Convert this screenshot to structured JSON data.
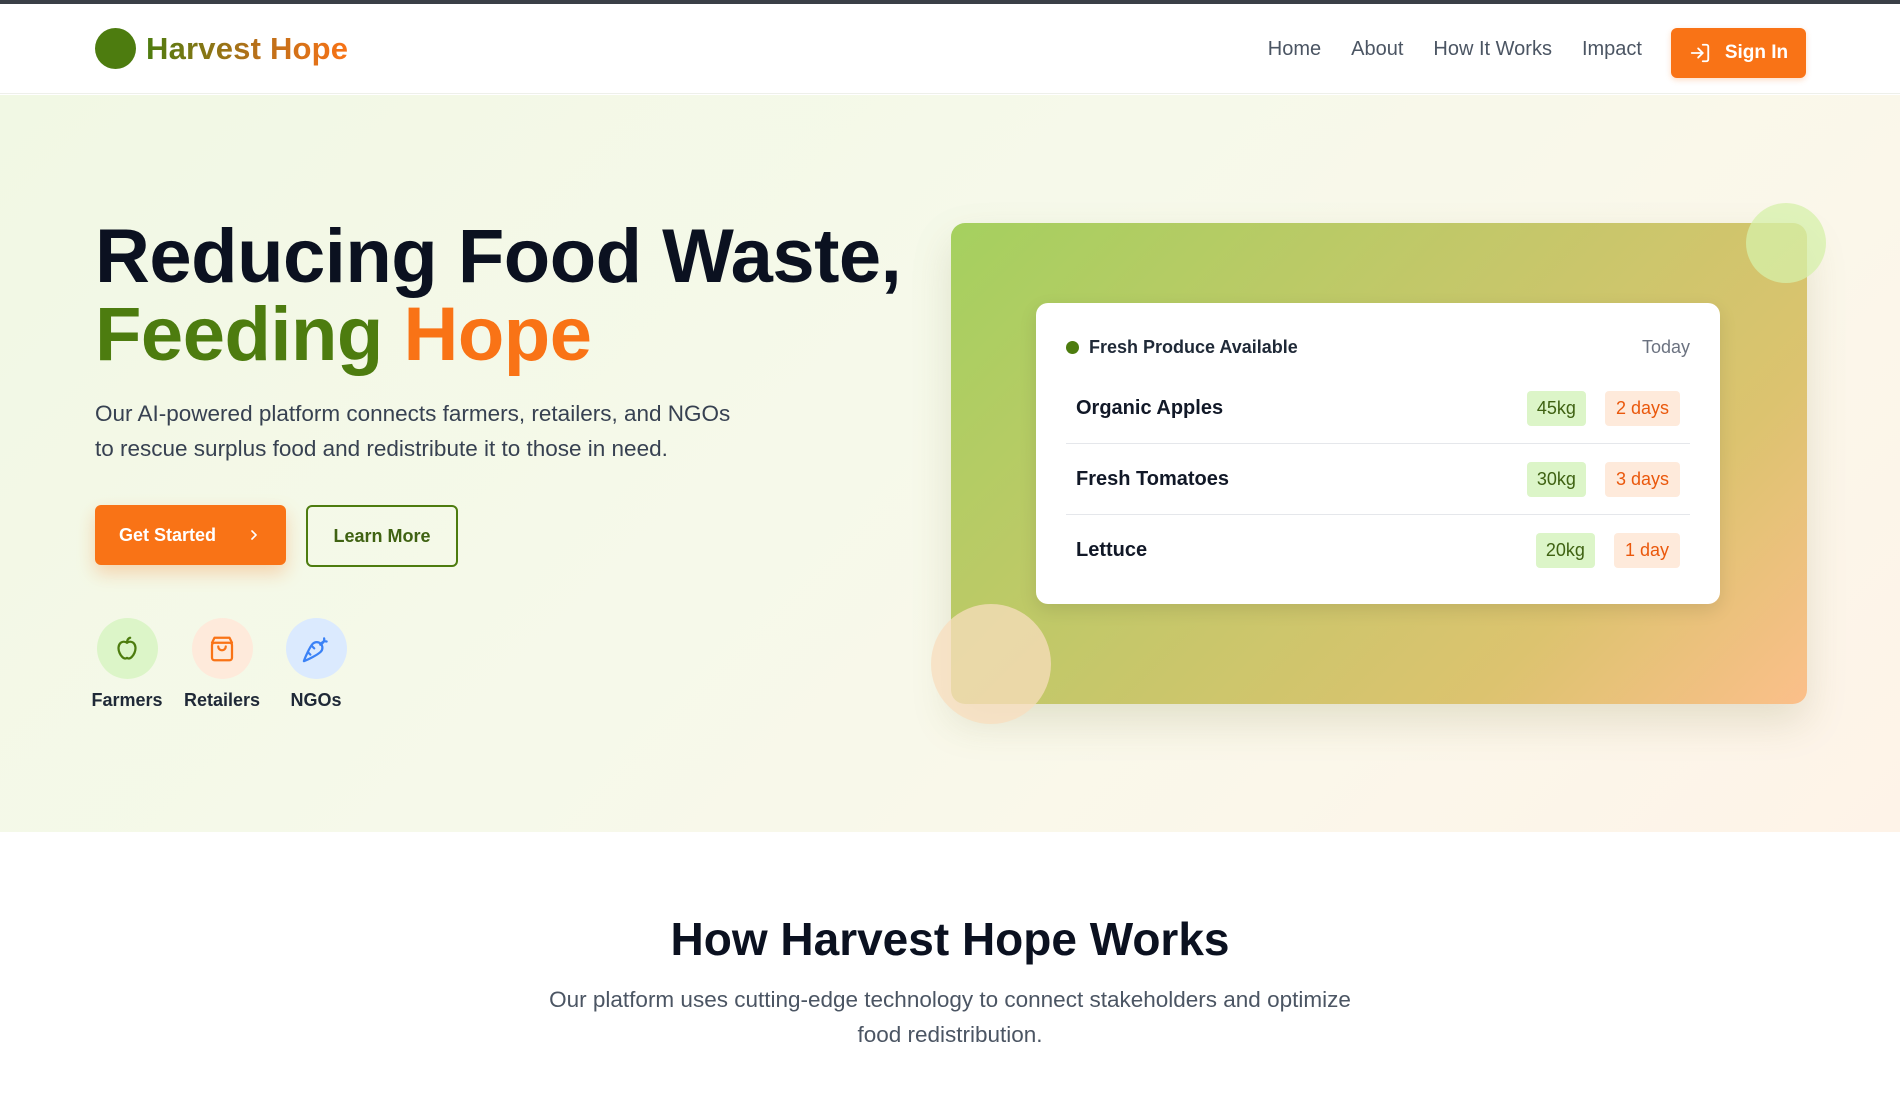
{
  "brand": {
    "name": "Harvest Hope"
  },
  "nav": {
    "links": [
      "Home",
      "About",
      "How It Works",
      "Impact"
    ],
    "signin_label": "Sign In"
  },
  "hero": {
    "title_line1": "Reducing Food Waste,",
    "title_word_green": "Feeding",
    "title_word_orange": "Hope",
    "lede": "Our AI-powered platform connects farmers, retailers, and NGOs to rescue surplus food and redistribute it to those in need.",
    "primary_cta": "Get Started",
    "secondary_cta": "Learn More",
    "stakeholders": [
      {
        "label": "Farmers",
        "icon": "apple-icon",
        "bg": "#dcf5c8",
        "color": "#4d7c0f"
      },
      {
        "label": "Retailers",
        "icon": "shopping-bag-icon",
        "bg": "#feeadb",
        "color": "#f97316"
      },
      {
        "label": "NGOs",
        "icon": "carrot-icon",
        "bg": "#dbeafe",
        "color": "#3b82f6"
      }
    ]
  },
  "produce_card": {
    "title": "Fresh Produce Available",
    "date": "Today",
    "items": [
      {
        "name": "Organic Apples",
        "qty": "45kg",
        "expiry": "2 days"
      },
      {
        "name": "Fresh Tomatoes",
        "qty": "30kg",
        "expiry": "3 days"
      },
      {
        "name": "Lettuce",
        "qty": "20kg",
        "expiry": "1 day"
      }
    ]
  },
  "how_it_works": {
    "title": "How Harvest Hope Works",
    "subtitle": "Our platform uses cutting-edge technology to connect stakeholders and optimize food redistribution."
  },
  "colors": {
    "brand_green": "#4d7c0f",
    "brand_orange": "#f97316",
    "text_dark": "#0b1120"
  }
}
